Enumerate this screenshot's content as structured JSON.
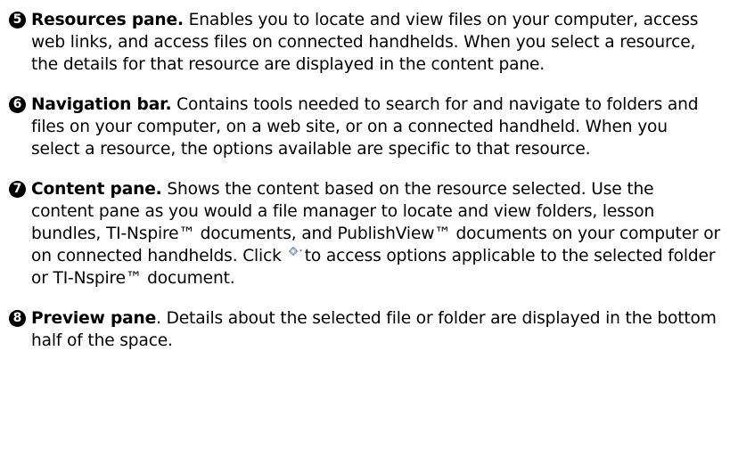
{
  "items": [
    {
      "number": "5",
      "term": "Resources pane.",
      "text": " Enables you to locate and view files on your computer, access web links, and access files on connected handhelds. When you select a resource, the details for that resource are displayed in the content pane."
    },
    {
      "number": "6",
      "term": "Navigation bar.",
      "text": " Contains tools needed to search for and navigate to folders and files on your computer, on a web site, or on a connected handheld. When you select a resource, the options available are specific to that resource."
    },
    {
      "number": "7",
      "term": "Content pane.",
      "text_before_icon": " Shows the content based on the resource selected. Use the content pane as you would a file manager to locate and view folders, lesson bundles, TI-Nspire™ documents, and PublishView™ documents on your computer or on connected handhelds. Click",
      "icon": "gear-options-icon",
      "text_after_icon": "to access options applicable to the selected folder or TI-Nspire™ document."
    },
    {
      "number": "8",
      "term": "Preview pane",
      "text": ". Details about the selected file or folder are displayed in the bottom half of the space."
    }
  ]
}
